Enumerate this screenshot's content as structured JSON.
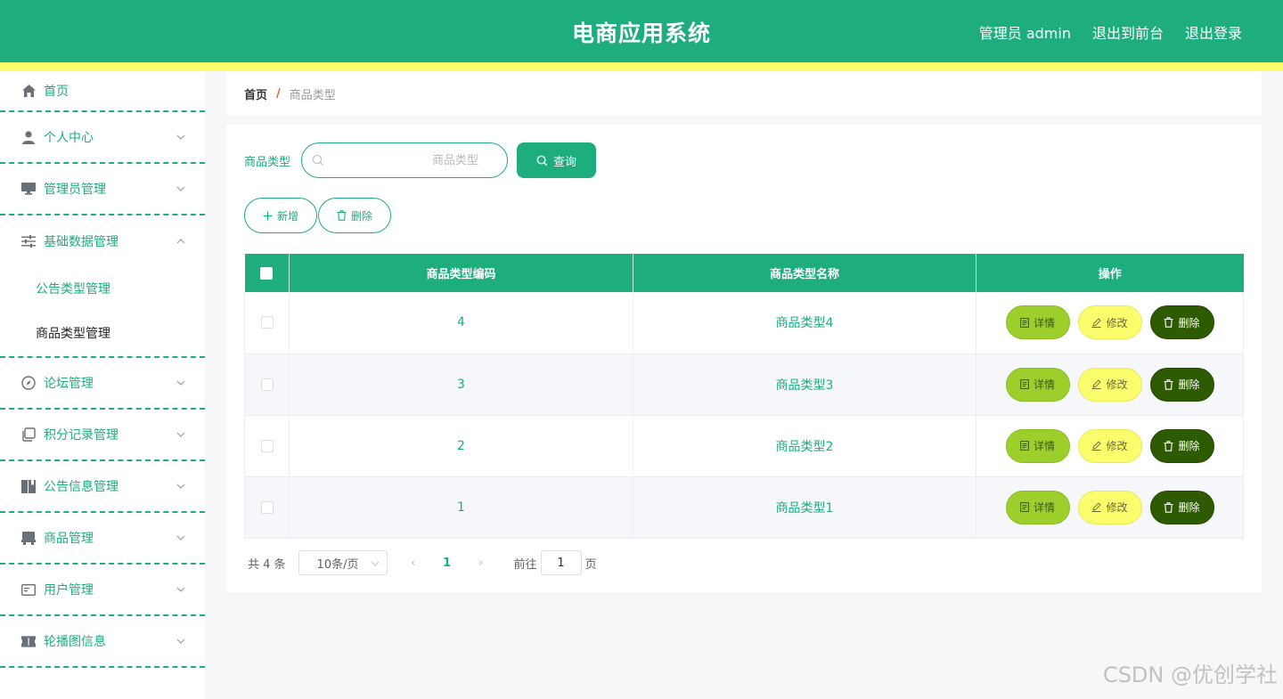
{
  "header": {
    "title": "电商应用系统",
    "admin_label": "管理员 admin",
    "to_front": "退出到前台",
    "logout": "退出登录"
  },
  "sidebar": {
    "items": [
      {
        "label": "首页",
        "icon": "home-icon"
      },
      {
        "label": "个人中心",
        "icon": "user-icon"
      },
      {
        "label": "管理员管理",
        "icon": "monitor-icon"
      },
      {
        "label": "基础数据管理",
        "icon": "sliders-icon"
      },
      {
        "label": "论坛管理",
        "icon": "compass-icon"
      },
      {
        "label": "积分记录管理",
        "icon": "copy-icon"
      },
      {
        "label": "公告信息管理",
        "icon": "book-icon"
      },
      {
        "label": "商品管理",
        "icon": "box-icon"
      },
      {
        "label": "用户管理",
        "icon": "id-card-icon"
      },
      {
        "label": "轮播图信息",
        "icon": "ticket-icon"
      }
    ],
    "sub_items": [
      "公告类型管理",
      "商品类型管理"
    ]
  },
  "breadcrumb": {
    "home": "首页",
    "separator": "/",
    "current": "商品类型"
  },
  "search": {
    "label": "商品类型",
    "placeholder": "商品类型",
    "query_button": "查询"
  },
  "actions": {
    "add": "新增",
    "delete": "删除"
  },
  "table": {
    "headers": [
      "商品类型编码",
      "商品类型名称",
      "操作"
    ],
    "rows": [
      {
        "code": "4",
        "name": "商品类型4"
      },
      {
        "code": "3",
        "name": "商品类型3"
      },
      {
        "code": "2",
        "name": "商品类型2"
      },
      {
        "code": "1",
        "name": "商品类型1"
      }
    ],
    "op_labels": {
      "detail": "详情",
      "edit": "修改",
      "delete": "删除"
    }
  },
  "pagination": {
    "total": "共 4 条",
    "page_size": "10条/页",
    "current_page": "1",
    "goto_label": "前往",
    "goto_value": "1",
    "page_suffix": "页"
  },
  "watermark": "CSDN @优创学社",
  "colors": {
    "primary": "#1ead7d",
    "accent_yellow": "#fbfd6c",
    "detail": "#9cce2c",
    "danger": "#2e5b02"
  }
}
